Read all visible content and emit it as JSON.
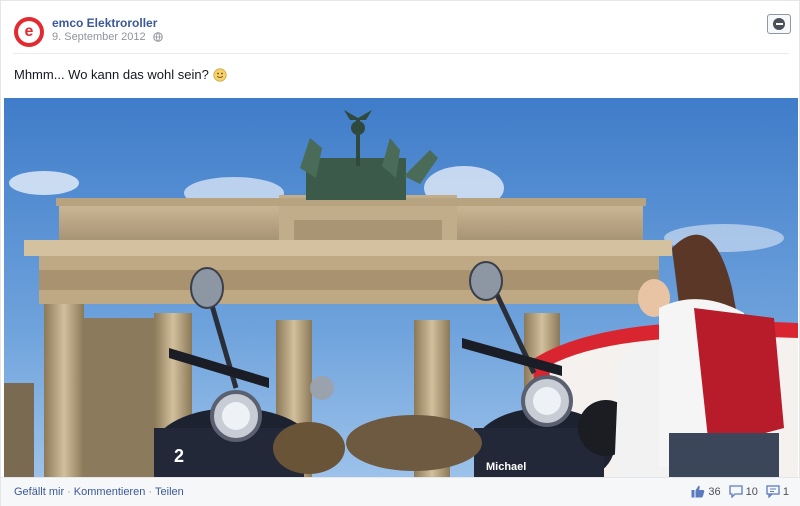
{
  "post": {
    "page_name": "emco Elektroroller",
    "date": "9. September 2012",
    "message": "Mhmm... Wo kann das wohl sein?"
  },
  "icons": {
    "avatar": "emco-logo",
    "privacy": "globe-icon",
    "menu": "hide-post-icon",
    "emoji": "smiley-icon",
    "likes": "thumbs-up-icon",
    "comments": "comment-icon",
    "shares": "share-icon"
  },
  "actions": {
    "like": "Gefällt mir",
    "comment": "Kommentieren",
    "share": "Teilen",
    "separator": "·"
  },
  "stats": {
    "likes": "36",
    "comments": "10",
    "shares": "1"
  },
  "photo": {
    "scooter_plate_left": "2",
    "scooter_label_right": "Michael"
  },
  "colors": {
    "brand_red": "#e32a30",
    "link_blue": "#3b5998",
    "muted_gray": "#90949c",
    "footer_bg": "#f6f7f9"
  }
}
